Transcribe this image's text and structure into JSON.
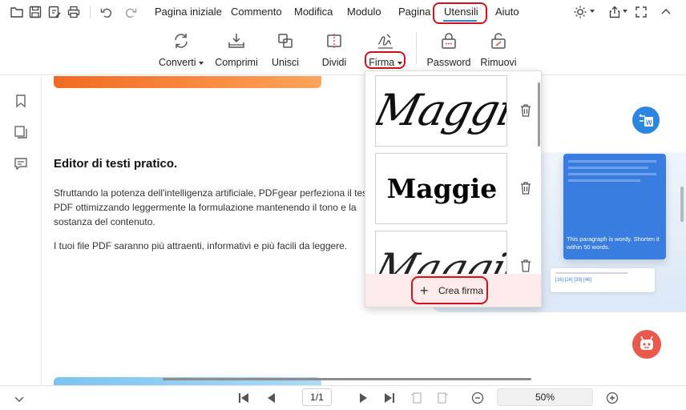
{
  "menu": {
    "items": [
      "Pagina iniziale",
      "Commento",
      "Modifica",
      "Modulo",
      "Pagina",
      "Utensili",
      "Aiuto"
    ],
    "active": "Utensili"
  },
  "toolbar": {
    "convert": "Converti",
    "compress": "Comprimi",
    "merge": "Unisci",
    "split": "Dividi",
    "sign": "Firma",
    "password": "Password",
    "remove": "Rimuovi"
  },
  "document": {
    "heading": "Editor di testi pratico.",
    "paragraph1_line1": "Sfruttando la potenza dell'intelligenza artificiale, PDFgear perfeziona il tes",
    "paragraph1_line2": "PDF ottimizzando leggermente la formulazione mantenendo il tono e la",
    "paragraph1_line3": "sostanza del contenuto.",
    "paragraph2": "I tuoi file PDF saranno più attraenti, informativi e più facili da leggere.",
    "card_text": "This paragraph is wordy. Shorten it within 50 words.",
    "refs": "[16] [24] [39] [46]"
  },
  "signatures": {
    "items": [
      "Maggie",
      "Maggie",
      "Maggie"
    ],
    "create": "Crea firma"
  },
  "footer": {
    "page": "1/1",
    "zoom": "50%"
  },
  "colors": {
    "highlight": "#d3111a",
    "accent_blue": "#2a86e0",
    "robot": "#ea5a4c",
    "orange_start": "#f26a21",
    "orange_end": "#ffa35a"
  }
}
